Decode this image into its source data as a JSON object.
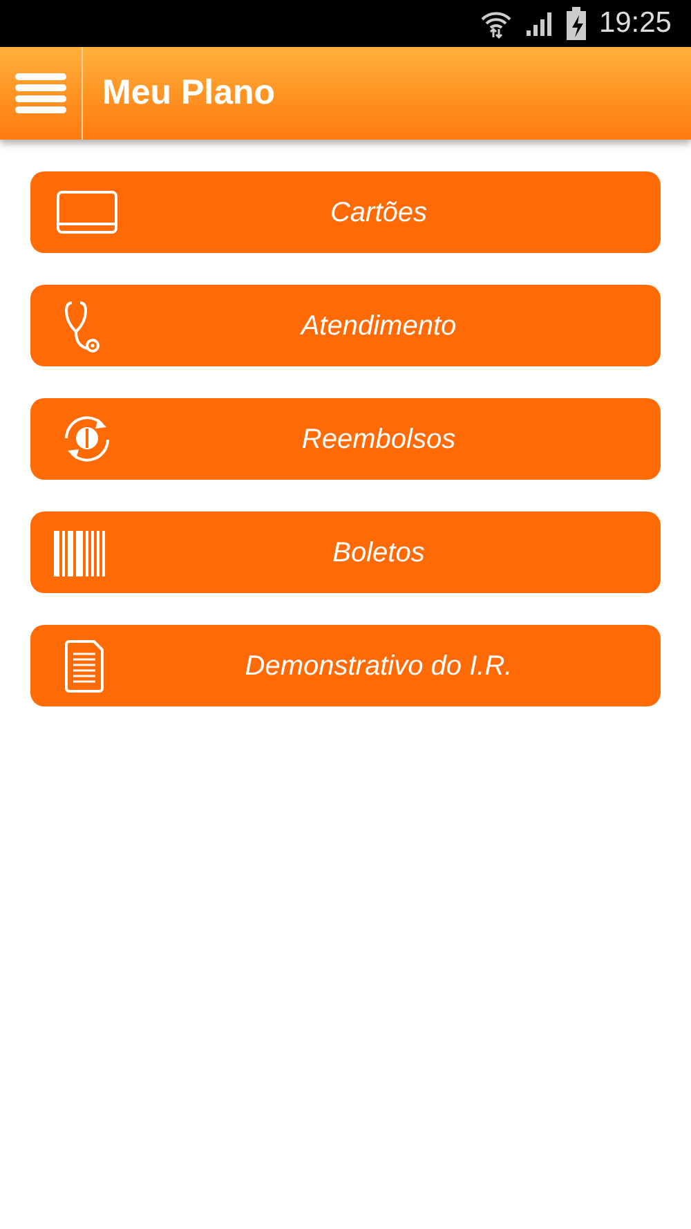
{
  "status_bar": {
    "time": "19:25"
  },
  "app_bar": {
    "title": "Meu Plano"
  },
  "menu_items": [
    {
      "kind": "card",
      "label": "Cartões"
    },
    {
      "kind": "stethoscope",
      "label": "Atendimento"
    },
    {
      "kind": "refund",
      "label": "Reembolsos"
    },
    {
      "kind": "barcode",
      "label": "Boletos"
    },
    {
      "kind": "document",
      "label": "Demonstrativo do I.R."
    }
  ]
}
